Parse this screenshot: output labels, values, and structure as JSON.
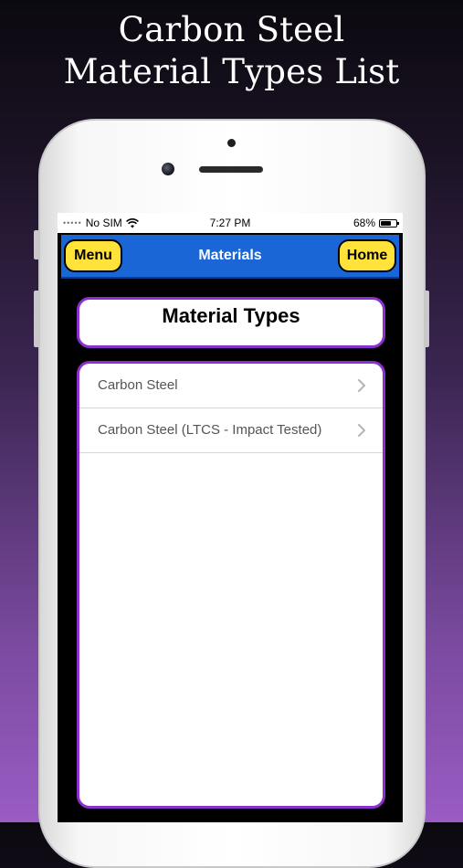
{
  "headline": {
    "line1": "Carbon Steel",
    "line2": "Material Types List"
  },
  "status_bar": {
    "carrier": "No SIM",
    "time": "7:27 PM",
    "battery_percent": "68%",
    "battery_level": 0.68
  },
  "nav": {
    "left_button": "Menu",
    "title": "Materials",
    "right_button": "Home"
  },
  "page": {
    "title": "Material Types"
  },
  "list": {
    "items": [
      {
        "label": "Carbon Steel"
      },
      {
        "label": "Carbon Steel (LTCS - Impact Tested)"
      }
    ]
  },
  "colors": {
    "nav_blue": "#1a66d6",
    "button_yellow": "#ffe33a",
    "card_border_purple": "#8b2fd1"
  },
  "icons": {
    "wifi": "wifi-icon",
    "battery": "battery-icon",
    "chevron": "chevron-right-icon"
  }
}
